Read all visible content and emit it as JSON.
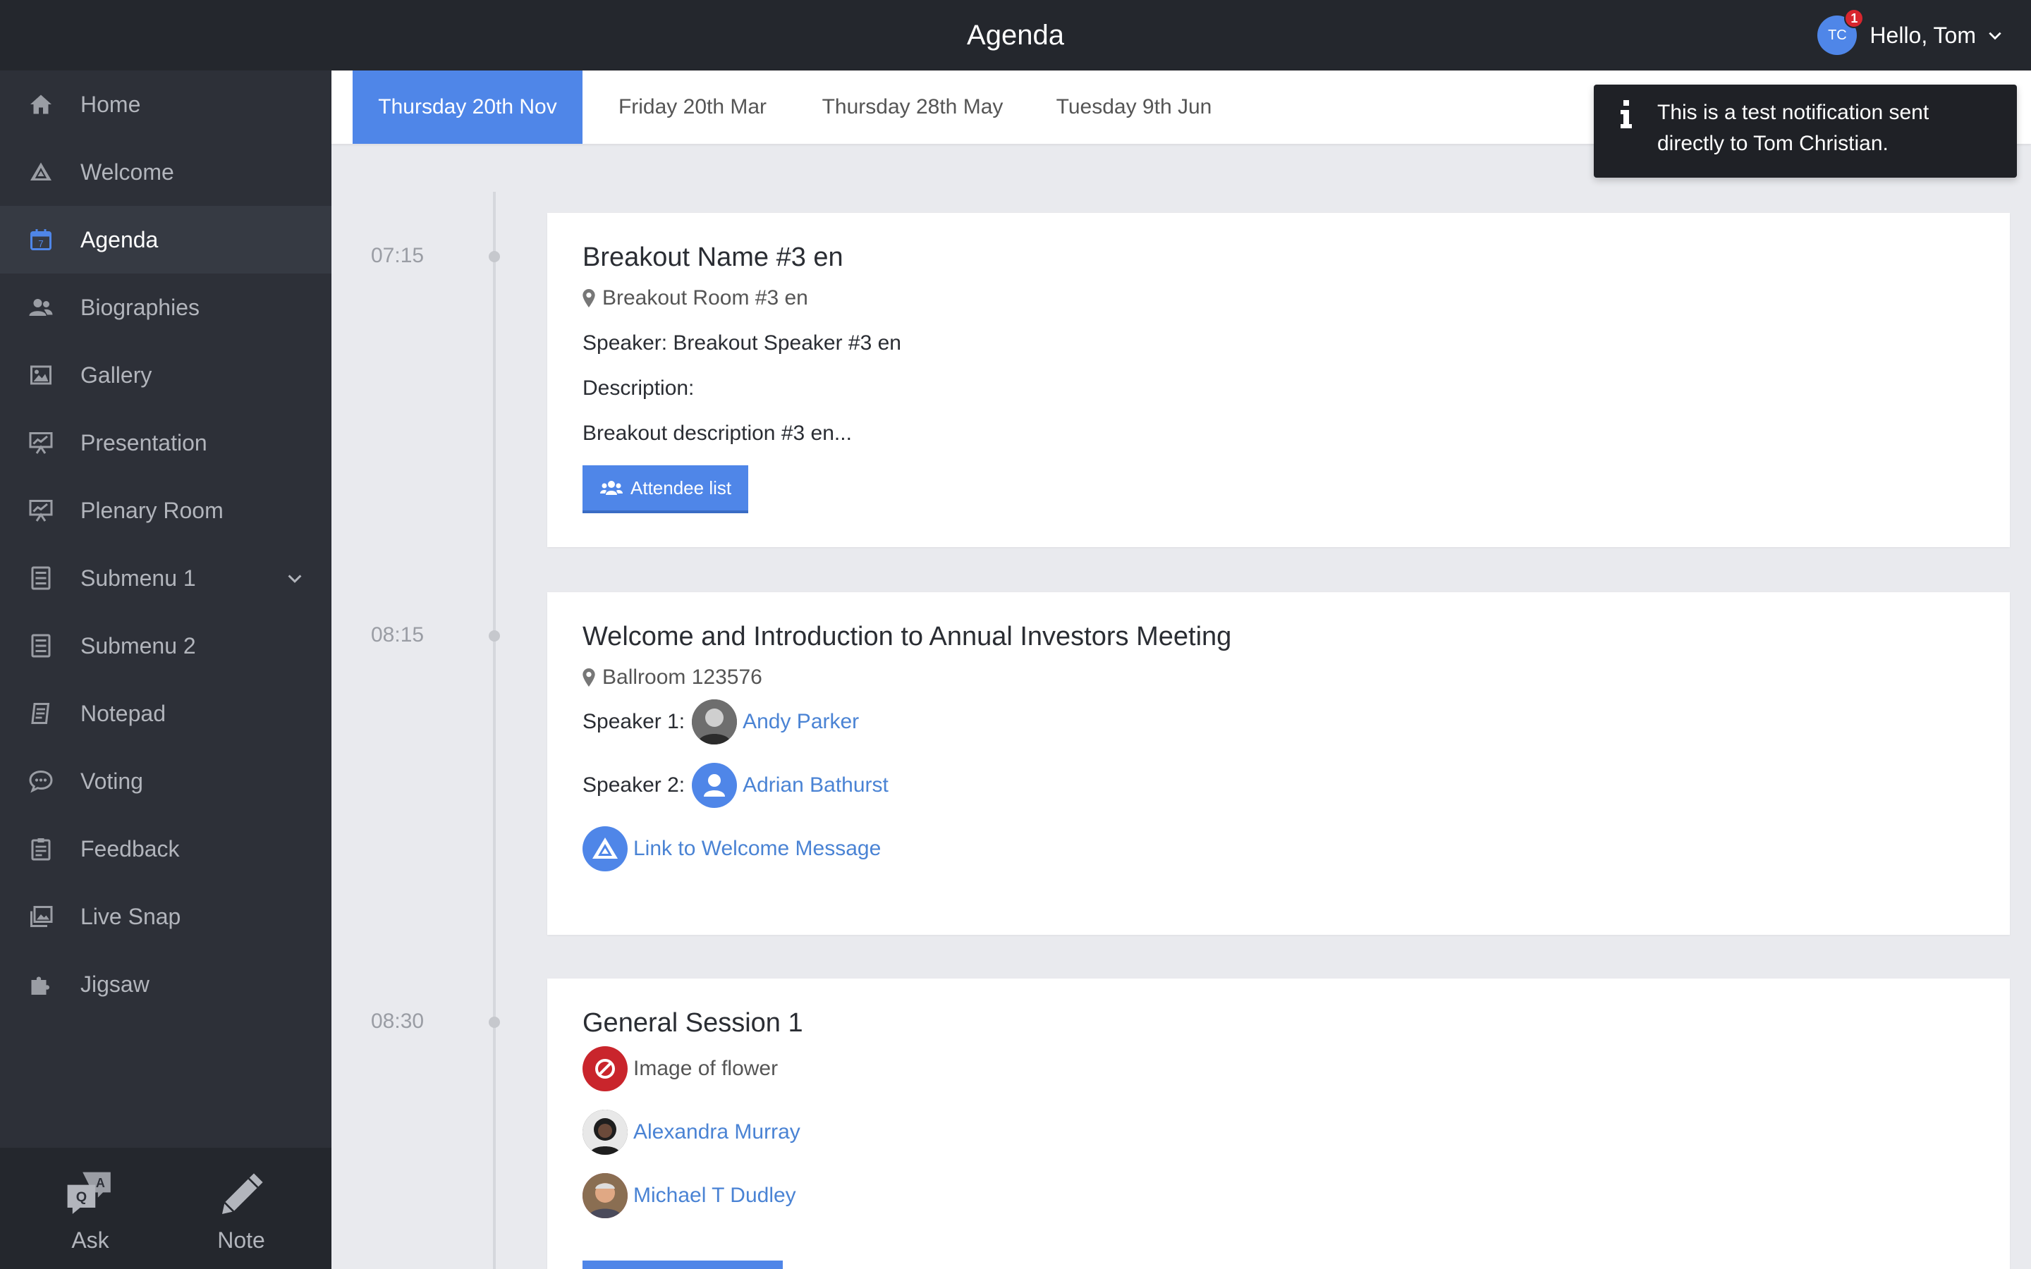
{
  "header": {
    "title": "Agenda",
    "user_greeting": "Hello, Tom",
    "user_initials": "TC",
    "notification_count": "1"
  },
  "sidebar": {
    "items": [
      {
        "label": "Home",
        "icon": "home-icon"
      },
      {
        "label": "Welcome",
        "icon": "triangle-logo-icon"
      },
      {
        "label": "Agenda",
        "icon": "calendar-icon",
        "active": true
      },
      {
        "label": "Biographies",
        "icon": "users-icon"
      },
      {
        "label": "Gallery",
        "icon": "image-icon"
      },
      {
        "label": "Presentation",
        "icon": "presentation-icon"
      },
      {
        "label": "Plenary Room",
        "icon": "presentation-icon"
      },
      {
        "label": "Submenu 1",
        "icon": "list-icon",
        "has_children": true
      },
      {
        "label": "Submenu 2",
        "icon": "list-icon"
      },
      {
        "label": "Notepad",
        "icon": "notepad-icon"
      },
      {
        "label": "Voting",
        "icon": "chat-icon"
      },
      {
        "label": "Feedback",
        "icon": "clipboard-icon"
      },
      {
        "label": "Live Snap",
        "icon": "photos-icon"
      },
      {
        "label": "Jigsaw",
        "icon": "puzzle-icon"
      }
    ],
    "bottom": {
      "ask_label": "Ask",
      "note_label": "Note"
    }
  },
  "tabs": [
    {
      "label": "Thursday 20th Nov",
      "active": true
    },
    {
      "label": "Friday 20th Mar"
    },
    {
      "label": "Thursday 28th May"
    },
    {
      "label": "Tuesday 9th Jun"
    }
  ],
  "notification": {
    "text": "This is a test notification sent directly to Tom Christian."
  },
  "sessions": [
    {
      "time": "07:15",
      "title": "Breakout Name #3 en",
      "location": "Breakout Room #3 en",
      "speaker_line": "Speaker: Breakout Speaker #3 en",
      "description_label": "Description:",
      "description": "Breakout description #3 en...",
      "button_label": "Attendee list"
    },
    {
      "time": "08:15",
      "title": "Welcome and Introduction to Annual Investors Meeting",
      "location": "Ballroom 123576",
      "speaker1_label": "Speaker 1:",
      "speaker1_name": "Andy Parker",
      "speaker2_label": "Speaker 2:",
      "speaker2_name": "Adrian Bathurst",
      "link_label": "Link to Welcome Message"
    },
    {
      "time": "08:30",
      "title": "General Session 1",
      "item_label": "Image of flower",
      "person1": "Alexandra Murray",
      "person2": "Michael T Dudley"
    }
  ],
  "colors": {
    "accent": "#4f86e8",
    "sidebar_bg": "#2d3038",
    "topbar_bg": "#24272d",
    "link": "#4a83d4",
    "badge": "#d8262e"
  }
}
